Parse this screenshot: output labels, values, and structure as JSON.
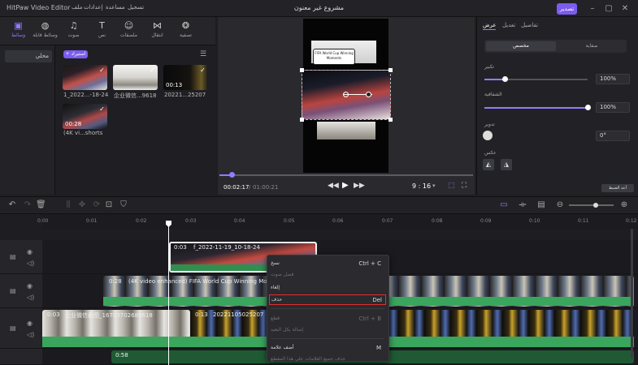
{
  "app": {
    "name": "HitPaw Video Editor",
    "project_title": "مشروع غير معنون",
    "export_label": "تصدير"
  },
  "menu": [
    "ملف",
    "إعدادات",
    "مساعدة",
    "تسجيل"
  ],
  "tools": [
    {
      "label": "وسائط",
      "icon": "media-icon"
    },
    {
      "label": "وسائط قابلة",
      "icon": "stock-icon"
    },
    {
      "label": "صوت",
      "icon": "audio-icon"
    },
    {
      "label": "نص",
      "icon": "text-icon"
    },
    {
      "label": "ملصقات",
      "icon": "sticker-icon"
    },
    {
      "label": "انتقال",
      "icon": "transition-icon"
    },
    {
      "label": "تصفية",
      "icon": "filter-icon"
    }
  ],
  "media": {
    "sidebar_item": "محلي",
    "import_label": "+ استيراد",
    "items": [
      {
        "caption": "1_2022...-18-24",
        "duration": ""
      },
      {
        "caption": "企业微信...9618",
        "duration": ""
      },
      {
        "caption": "20221...25207",
        "duration": "00:13"
      },
      {
        "caption": "(4K vi...shorts",
        "duration": "00:28"
      }
    ]
  },
  "preview": {
    "current_time": "00:02:17",
    "total_time": "01:00:21",
    "aspect": "9 : 16",
    "canvas_text": "FIFA World Cup Winning Moments"
  },
  "properties": {
    "tabs": [
      "عرض",
      "تعديل",
      "تفاصيل"
    ],
    "subtabs": [
      "مخصص",
      "صفاية"
    ],
    "scale_label": "تكبير",
    "scale_value": "100%",
    "opacity_label": "الشفافية",
    "opacity_value": "100%",
    "rotate_label": "تدوير",
    "rotate_value": "0°",
    "flip_label": "عكس",
    "reset_label": "أعد الضبط",
    "scale_level": 0.2,
    "opacity_level": 1.0
  },
  "timeline": {
    "ruler_ticks": [
      "0:00",
      "0:01",
      "0:02",
      "0:03",
      "0:04",
      "0:05",
      "0:06",
      "0:07",
      "0:08",
      "0:09",
      "0:10",
      "0:11",
      "0:12"
    ],
    "clips": {
      "top": {
        "duration": "0:03",
        "name": "f_2022-11-19_10-18-24"
      },
      "middle": {
        "duration": "0:28",
        "name": "(4K video enhanced) FIFA World Cup Winning Mo"
      },
      "bottom_a": {
        "duration": "0:03",
        "name": "企业微信截图_16703702689618"
      },
      "bottom_b": {
        "duration": "0:13",
        "name": "20221105025207"
      },
      "bottom_c": {
        "duration": "0:58",
        "name": ""
      }
    }
  },
  "context_menu": {
    "items": [
      {
        "label": "نسخ",
        "key": "Ctrl + C",
        "enabled": true
      },
      {
        "label": "فصل صوت",
        "key": "",
        "enabled": false
      },
      {
        "label": "إلغاء",
        "key": "",
        "enabled": true
      },
      {
        "label": "حذف",
        "key": "Del",
        "enabled": true,
        "highlighted": true
      },
      {
        "label": "قطع",
        "key": "Ctrl + B",
        "enabled": false
      },
      {
        "label": "إسالة بكل البعيد",
        "key": "",
        "enabled": false
      },
      {
        "label": "أضف علامة",
        "key": "M",
        "enabled": true
      },
      {
        "label": "حذف جميع العلامات على هذا المقطع",
        "key": "",
        "enabled": false
      }
    ]
  },
  "colors": {
    "accent": "#8f7dff",
    "highlight_border": "#e0302c",
    "audio_green": "#3aa55c"
  }
}
